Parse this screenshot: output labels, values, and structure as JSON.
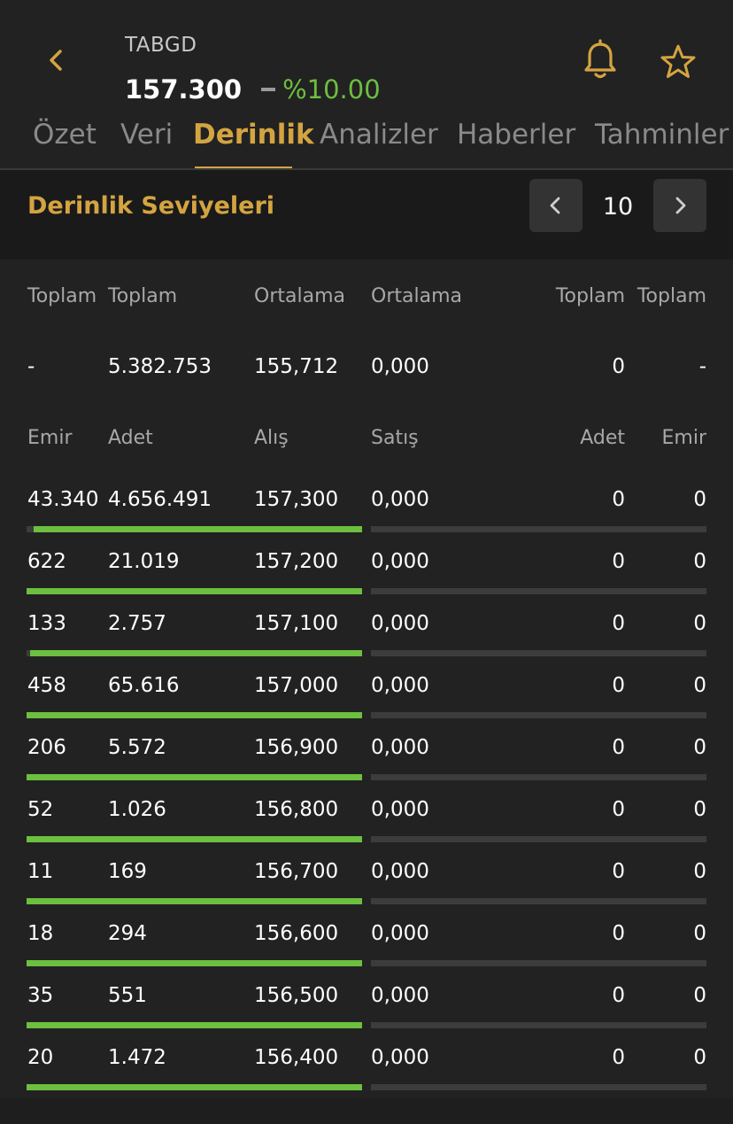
{
  "header": {
    "symbol": "TABGD",
    "price": "157.300",
    "change_pct": "%10.00",
    "accent_color": "#d4a441",
    "positive_color": "#6cbf3f"
  },
  "tabs": [
    {
      "label": "Özet",
      "active": false
    },
    {
      "label": "Veri",
      "active": false
    },
    {
      "label": "Derinlik",
      "active": true
    },
    {
      "label": "Analizler",
      "active": false
    },
    {
      "label": "Haberler",
      "active": false
    },
    {
      "label": "Tahminler",
      "active": false
    }
  ],
  "depth": {
    "title": "Derinlik Seviyeleri",
    "level": "10"
  },
  "summary": {
    "headers": [
      "Toplam",
      "Toplam",
      "Ortalama",
      "Ortalama",
      "Toplam",
      "Toplam"
    ],
    "values": [
      "-",
      "5.382.753",
      "155,712",
      "0,000",
      "0",
      "-"
    ]
  },
  "columns": [
    "Emir",
    "Adet",
    "Alış",
    "Satış",
    "Adet",
    "Emir"
  ],
  "rows": [
    {
      "bid_orders": "43.340",
      "bid_qty": "4.656.491",
      "bid": "157,300",
      "ask": "0,000",
      "ask_qty": "0",
      "ask_orders": "0",
      "bid_fill": 0.98
    },
    {
      "bid_orders": "622",
      "bid_qty": "21.019",
      "bid": "157,200",
      "ask": "0,000",
      "ask_qty": "0",
      "ask_orders": "0",
      "bid_fill": 1.0
    },
    {
      "bid_orders": "133",
      "bid_qty": "2.757",
      "bid": "157,100",
      "ask": "0,000",
      "ask_qty": "0",
      "ask_orders": "0",
      "bid_fill": 0.99
    },
    {
      "bid_orders": "458",
      "bid_qty": "65.616",
      "bid": "157,000",
      "ask": "0,000",
      "ask_qty": "0",
      "ask_orders": "0",
      "bid_fill": 1.0
    },
    {
      "bid_orders": "206",
      "bid_qty": "5.572",
      "bid": "156,900",
      "ask": "0,000",
      "ask_qty": "0",
      "ask_orders": "0",
      "bid_fill": 1.0
    },
    {
      "bid_orders": "52",
      "bid_qty": "1.026",
      "bid": "156,800",
      "ask": "0,000",
      "ask_qty": "0",
      "ask_orders": "0",
      "bid_fill": 1.0
    },
    {
      "bid_orders": "11",
      "bid_qty": "169",
      "bid": "156,700",
      "ask": "0,000",
      "ask_qty": "0",
      "ask_orders": "0",
      "bid_fill": 1.0
    },
    {
      "bid_orders": "18",
      "bid_qty": "294",
      "bid": "156,600",
      "ask": "0,000",
      "ask_qty": "0",
      "ask_orders": "0",
      "bid_fill": 1.0
    },
    {
      "bid_orders": "35",
      "bid_qty": "551",
      "bid": "156,500",
      "ask": "0,000",
      "ask_qty": "0",
      "ask_orders": "0",
      "bid_fill": 1.0
    },
    {
      "bid_orders": "20",
      "bid_qty": "1.472",
      "bid": "156,400",
      "ask": "0,000",
      "ask_qty": "0",
      "ask_orders": "0",
      "bid_fill": 1.0
    }
  ],
  "icons": {
    "back": "chevron-left-icon",
    "alert": "bell-icon",
    "favorite": "star-icon",
    "prev": "chevron-left-icon",
    "next": "chevron-right-icon"
  }
}
